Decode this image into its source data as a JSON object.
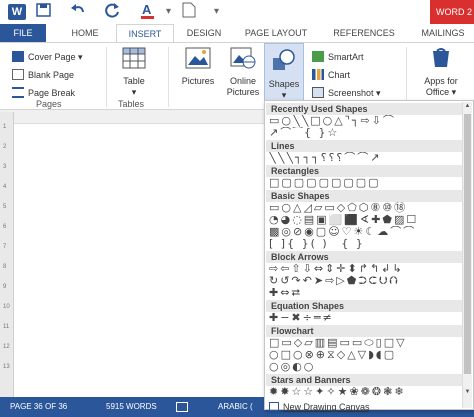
{
  "title_bar": {
    "app_title": "WORD 2"
  },
  "tabs": [
    "FILE",
    "HOME",
    "INSERT",
    "DESIGN",
    "PAGE LAYOUT",
    "REFERENCES",
    "MAILINGS"
  ],
  "ribbon": {
    "pages": {
      "cover_page": "Cover Page ▾",
      "blank_page": "Blank Page",
      "page_break": "Page Break",
      "label": "Pages"
    },
    "tables": {
      "table": "Table",
      "label": "Tables"
    },
    "illustrations": {
      "pictures": "Pictures",
      "online_pictures_1": "Online",
      "online_pictures_2": "Pictures",
      "shapes": "Shapes",
      "smartart": "SmartArt",
      "chart": "Chart",
      "screenshot": "Screenshot ▾"
    },
    "apps": {
      "apps_1": "Apps for",
      "apps_2": "Office ▾"
    }
  },
  "ruler": {
    "marks": [
      "1",
      "2",
      "3",
      "4",
      "5",
      "6",
      "7",
      "8",
      "9",
      "10",
      "11",
      "12",
      "13"
    ]
  },
  "shapes_menu": {
    "sections": [
      {
        "title": "Recently Used Shapes",
        "rows": [
          "▭○╲╲□○△⌝┐⇨⇩⌒",
          "↗⌒⁀{ }☆"
        ]
      },
      {
        "title": "Lines",
        "rows": [
          "╲╲╲┐┐┐⸮⸮⸮⌒⌒↗"
        ]
      },
      {
        "title": "Rectangles",
        "rows": [
          "□▢▢▢▢▢▢▢▢"
        ]
      },
      {
        "title": "Basic Shapes",
        "rows": [
          "▭○△◿▱▭◇⬠⬡⑧⑩⑱",
          "◔◕◌▤▣⬜⬛∢✚⬟▨☐",
          "▩◎⊘◉▢☺♡☀☾☁⌒⌒",
          "[ ]{ }( )   { }"
        ]
      },
      {
        "title": "Block Arrows",
        "rows": [
          "⇨⇦⇧⇩⇔⇕✛⬍↱↰↲↳",
          "↻↺↷↶➤⇨▷⬟⮊⮈⮋⮉",
          "✚⇔⮂"
        ]
      },
      {
        "title": "Equation Shapes",
        "rows": [
          "✚−✖÷═≠"
        ]
      },
      {
        "title": "Flowchart",
        "rows": [
          "□▭◇▱▥▤▭▭⬭▯□▽",
          "○□○⊗⊕⧖◇△▽◗◖▢",
          "○◎◐○"
        ]
      },
      {
        "title": "Stars and Banners",
        "rows": [
          "✹✸☆☆✦✧★❀❁❂❃❄",
          "❀❁❂❃❄❅❆❇"
        ]
      }
    ],
    "new_canvas": "New Drawing Canvas"
  },
  "status_bar": {
    "page": "PAGE 36 OF 36",
    "words": "5915 WORDS",
    "language": "ARABIC ("
  },
  "colors": {
    "accent": "#2b579a",
    "title_red": "#d9302f"
  }
}
